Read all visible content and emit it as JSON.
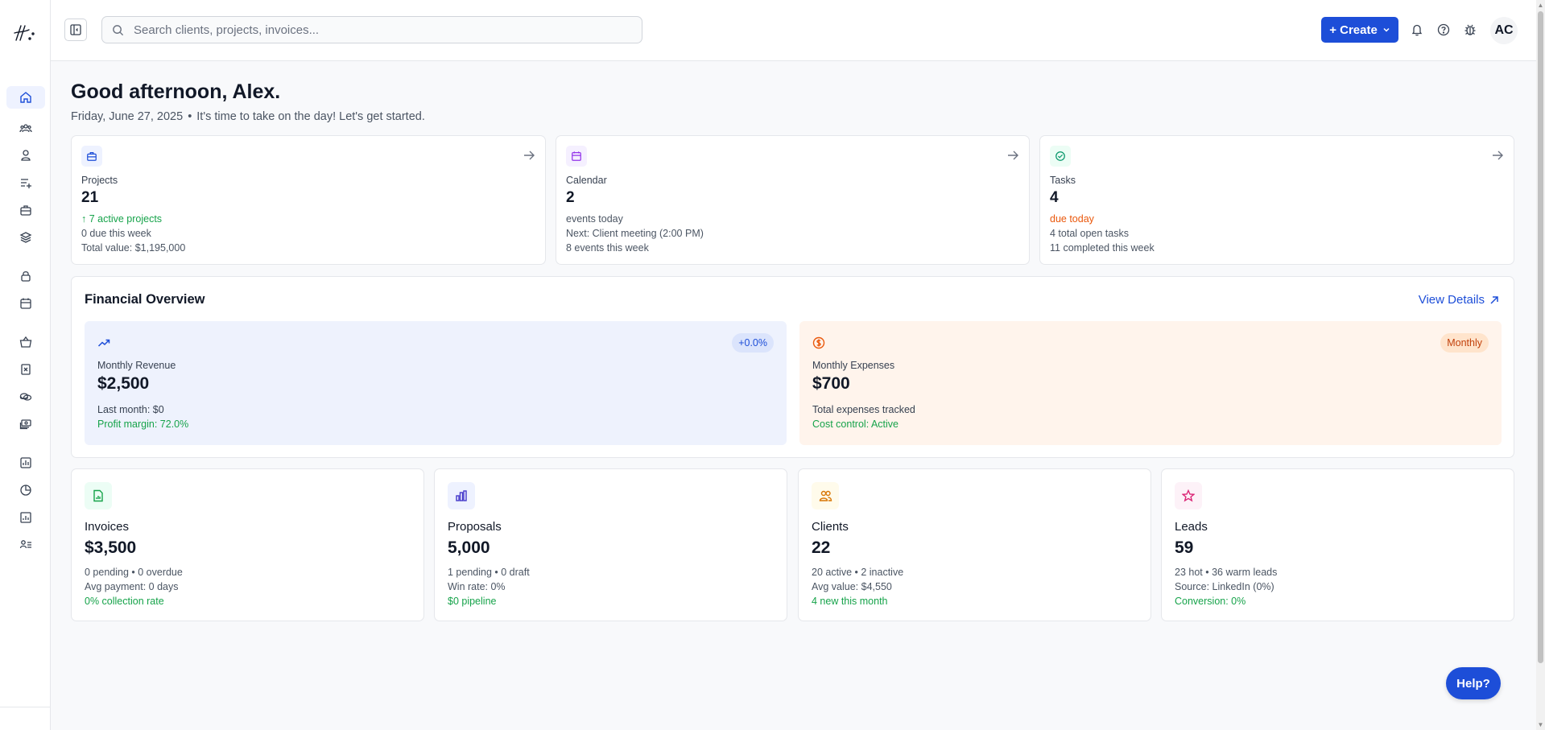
{
  "search": {
    "placeholder": "Search clients, projects, invoices..."
  },
  "topbar": {
    "create_label": "+ Create",
    "avatar_initials": "AC"
  },
  "greeting": {
    "title": "Good afternoon, Alex.",
    "date": "Friday, June 27, 2025",
    "separator": "•",
    "message": "It's time to take on the day! Let's get started."
  },
  "stats": {
    "projects": {
      "label": "Projects",
      "value": "21",
      "line1": "↑ 7 active projects",
      "line2": "0 due this week",
      "line3": "Total value: $1,195,000"
    },
    "calendar": {
      "label": "Calendar",
      "value": "2",
      "line1": "events today",
      "line2": "Next: Client meeting (2:00 PM)",
      "line3": "8 events this week"
    },
    "tasks": {
      "label": "Tasks",
      "value": "4",
      "line1": "due today",
      "line2": "4 total open tasks",
      "line3": "11 completed this week"
    }
  },
  "financial": {
    "title": "Financial Overview",
    "view_details": "View Details",
    "revenue": {
      "label": "Monthly Revenue",
      "value": "$2,500",
      "badge": "+0.0%",
      "line1": "Last month: $0",
      "line2": "Profit margin: 72.0%"
    },
    "expenses": {
      "label": "Monthly Expenses",
      "value": "$700",
      "badge": "Monthly",
      "line1": "Total expenses tracked",
      "line2": "Cost control: Active"
    }
  },
  "summary": {
    "invoices": {
      "label": "Invoices",
      "value": "$3,500",
      "line1": "0 pending • 0 overdue",
      "line2": "Avg payment: 0 days",
      "line3": "0% collection rate"
    },
    "proposals": {
      "label": "Proposals",
      "value": "5,000",
      "line1": "1 pending • 0 draft",
      "line2": "Win rate: 0%",
      "line3": "$0 pipeline"
    },
    "clients": {
      "label": "Clients",
      "value": "22",
      "line1": "20 active • 2 inactive",
      "line2": "Avg value: $4,550",
      "line3": "4 new this month"
    },
    "leads": {
      "label": "Leads",
      "value": "59",
      "line1": "23 hot • 36 warm leads",
      "line2": "Source: LinkedIn (0%)",
      "line3": "Conversion: 0%"
    }
  },
  "help_label": "Help?",
  "colors": {
    "primary": "#1d4ed8",
    "success": "#16a34a",
    "warning": "#ea580c",
    "revenue_bg": "#eef2fd",
    "expenses_bg": "#fff4ec"
  },
  "icons": {
    "sidebar": [
      "home-icon",
      "team-icon",
      "user-icon",
      "list-add-icon",
      "briefcase-icon",
      "layers-icon",
      "lock-icon",
      "calendar-icon",
      "basket-icon",
      "receipt-icon",
      "coins-icon",
      "money-stack-icon",
      "chart-icon",
      "pie-chart-icon",
      "bar-report-icon",
      "user-list-icon"
    ]
  }
}
